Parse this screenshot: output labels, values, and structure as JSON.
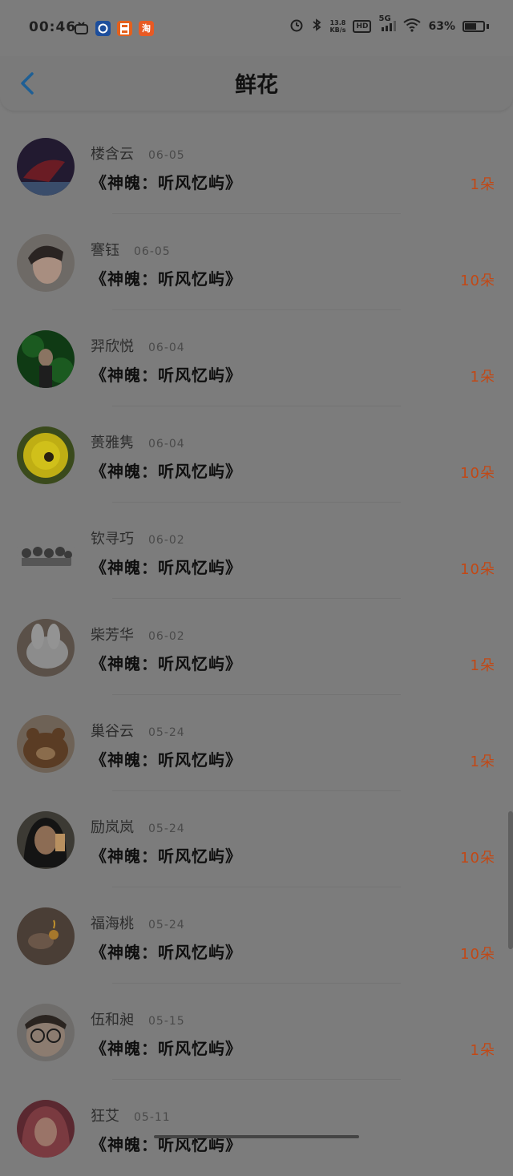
{
  "status_bar": {
    "time": "00:46",
    "net_speed": "13.8",
    "net_speed_unit": "KB/s",
    "hd": "HD",
    "signal": "5G",
    "battery": "63%",
    "battery_level": 0.63,
    "apps": [
      {
        "icon": "tv-icon",
        "label": "",
        "color": "#7c7c7c"
      },
      {
        "icon": "app-icon-blue",
        "label": "",
        "color": "#1d4e9c"
      },
      {
        "icon": "app-icon-orange",
        "label": "",
        "color": "#e4601c"
      },
      {
        "icon": "taobao-icon",
        "label": "淘",
        "color": "#e85a24"
      }
    ]
  },
  "header": {
    "title": "鲜花"
  },
  "colors": {
    "accent_blue": "#1e5f95",
    "count_orange": "#c24815"
  },
  "rows": [
    {
      "name": "楼含云",
      "date": "06-05",
      "book": "《神魄：听风忆屿》",
      "count": "1朵"
    },
    {
      "name": "謇钰",
      "date": "06-05",
      "book": "《神魄：听风忆屿》",
      "count": "10朵"
    },
    {
      "name": "羿欣悦",
      "date": "06-04",
      "book": "《神魄：听风忆屿》",
      "count": "1朵"
    },
    {
      "name": "蒉雅隽",
      "date": "06-04",
      "book": "《神魄：听风忆屿》",
      "count": "10朵"
    },
    {
      "name": "钦寻巧",
      "date": "06-02",
      "book": "《神魄：听风忆屿》",
      "count": "10朵"
    },
    {
      "name": "柴芳华",
      "date": "06-02",
      "book": "《神魄：听风忆屿》",
      "count": "1朵"
    },
    {
      "name": "巢谷云",
      "date": "05-24",
      "book": "《神魄：听风忆屿》",
      "count": "1朵"
    },
    {
      "name": "励岚岚",
      "date": "05-24",
      "book": "《神魄：听风忆屿》",
      "count": "10朵"
    },
    {
      "name": "福海桃",
      "date": "05-24",
      "book": "《神魄：听风忆屿》",
      "count": "10朵"
    },
    {
      "name": "伍和昶",
      "date": "05-15",
      "book": "《神魄：听风忆屿》",
      "count": "1朵"
    },
    {
      "name": "狂艾",
      "date": "05-11",
      "book": "《神魄：听风忆屿》",
      "count": ""
    }
  ]
}
